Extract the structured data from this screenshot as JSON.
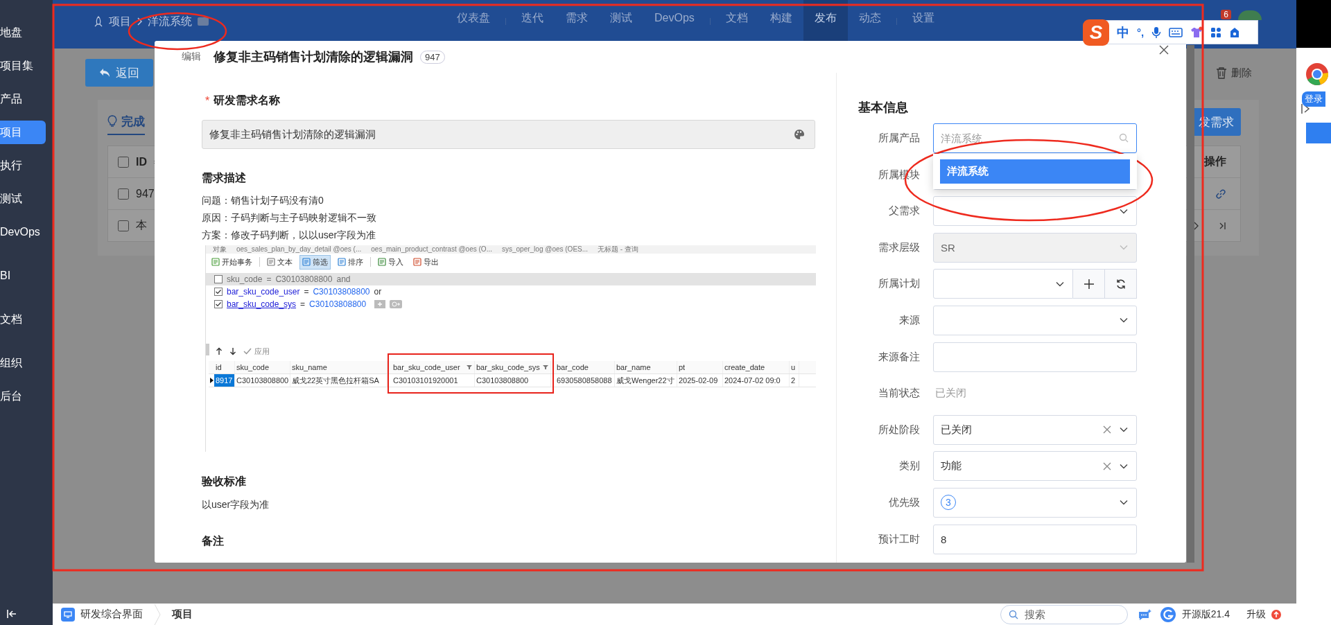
{
  "sidebar": {
    "items": [
      {
        "label": "地盘",
        "selected": false
      },
      {
        "label": "项目集",
        "selected": false
      },
      {
        "label": "产品",
        "selected": false
      },
      {
        "label": "项目",
        "selected": true
      },
      {
        "label": "执行",
        "selected": false
      },
      {
        "label": "测试",
        "selected": false
      },
      {
        "label": "DevOps",
        "selected": false
      },
      {
        "label": "BI",
        "selected": false
      },
      {
        "label": "文档",
        "selected": false
      },
      {
        "label": "组织",
        "selected": false
      },
      {
        "label": "后台",
        "selected": false
      }
    ]
  },
  "header": {
    "breadcrumb": [
      "项目",
      "洋流系统"
    ],
    "nav": [
      {
        "label": "仪表盘",
        "selected": false
      },
      {
        "label": "迭代",
        "selected": false
      },
      {
        "label": "需求",
        "selected": false
      },
      {
        "label": "测试",
        "selected": false
      },
      {
        "label": "DevOps",
        "selected": false
      },
      {
        "label": "文档",
        "selected": false
      },
      {
        "label": "构建",
        "selected": false
      },
      {
        "label": "发布",
        "selected": true
      },
      {
        "label": "动态",
        "selected": false
      },
      {
        "label": "设置",
        "selected": false
      }
    ],
    "notification_count": "6"
  },
  "ime_toolbar": {
    "logo": "S",
    "mode": "中",
    "punctuation": "°,"
  },
  "page": {
    "back_button": "返回",
    "delete_button": "删除",
    "tab": "完成",
    "new_button": "发需求",
    "id_column": "ID",
    "action_column": "操作",
    "select_all_checked": false,
    "rows": [
      {
        "kind": "story",
        "text": "947",
        "checked": false
      },
      {
        "kind": "footer",
        "text": "本",
        "checked": false
      }
    ]
  },
  "modal": {
    "mode": "编辑",
    "title": "修复非主码销售计划清除的逻辑漏洞",
    "id": "947",
    "required_mark": "*",
    "name_label": "研发需求名称",
    "name_value": "修复非主码销售计划清除的逻辑漏洞",
    "description_label": "需求描述",
    "description_lines": [
      "问题：销售计划子码没有清0",
      "原因：子码判断与主子码映射逻辑不一致",
      "方案：修改子码判断，以以user字段为准"
    ],
    "screenshot": {
      "tabs": [
        "对象",
        "oes_sales_plan_by_day_detail @oes (...",
        "oes_main_product_contrast @oes (O...",
        "sys_oper_log @oes (OES...",
        "无标题 - 查询"
      ],
      "toolbar": [
        {
          "label": "开始事务",
          "selected": false
        },
        {
          "label": "文本",
          "selected": false
        },
        {
          "label": "筛选",
          "selected": true
        },
        {
          "label": "排序",
          "selected": false
        },
        {
          "label": "导入",
          "selected": false
        },
        {
          "label": "导出",
          "selected": false
        }
      ],
      "filters": [
        {
          "checked": false,
          "field": "sku_code",
          "op": "=",
          "value": "C30103808800",
          "join": "and"
        },
        {
          "checked": true,
          "field": "bar_sku_code_user",
          "op": "=",
          "value": "C30103808800",
          "join": "or"
        },
        {
          "checked": true,
          "field": "bar_sku_code_sys",
          "op": "=",
          "value": "C30103808800"
        }
      ],
      "apply": "应用",
      "columns": [
        "id",
        "sku_code",
        "sku_name",
        "bar_sku_code_user",
        "bar_sku_code_sys",
        "bar_code",
        "bar_name",
        "pt",
        "create_date",
        "u"
      ],
      "rows": [
        [
          "8917",
          "C30103808800",
          "威戈22英寸黑色拉杆箱SA",
          "C30103101920001",
          "C30103808800",
          "6930580858088",
          "威戈Wenger22寸",
          "2025-02-09",
          "2024-07-02 09:0",
          "2"
        ]
      ]
    },
    "acceptance_label": "验收标准",
    "acceptance_text": "以user字段为准",
    "notes_label": "备注",
    "info_title": "基本信息",
    "fields": [
      {
        "label": "所属产品",
        "kind": "search",
        "placeholder": "洋流系统",
        "focused": true,
        "disabled": false,
        "clearable": false,
        "options": [
          {
            "label": "洋流系统",
            "selected": true
          }
        ]
      },
      {
        "label": "所属模块",
        "kind": "select"
      },
      {
        "label": "父需求",
        "kind": "select",
        "focused": false,
        "disabled": false,
        "clearable": false
      },
      {
        "label": "需求层级",
        "kind": "select",
        "value": "SR",
        "focused": false,
        "disabled": true,
        "clearable": false
      },
      {
        "label": "所属计划",
        "kind": "plan",
        "focused": false,
        "disabled": false,
        "clearable": false
      },
      {
        "label": "来源",
        "kind": "select",
        "focused": false,
        "disabled": false,
        "clearable": false
      },
      {
        "label": "来源备注",
        "kind": "input",
        "focused": false,
        "disabled": false,
        "clearable": false
      },
      {
        "label": "当前状态",
        "kind": "text",
        "value": "已关闭",
        "focused": false,
        "disabled": false,
        "clearable": false
      },
      {
        "label": "所处阶段",
        "kind": "select",
        "value": "已关闭",
        "focused": false,
        "disabled": false,
        "clearable": true
      },
      {
        "label": "类别",
        "kind": "select",
        "value": "功能",
        "focused": false,
        "disabled": false,
        "clearable": true
      },
      {
        "label": "优先级",
        "kind": "priority",
        "value": "3",
        "focused": false,
        "disabled": false,
        "clearable": false
      },
      {
        "label": "预计工时",
        "kind": "input",
        "value": "8",
        "focused": false,
        "disabled": false,
        "clearable": false
      }
    ]
  },
  "status_bar": {
    "app": "研发综合界面",
    "current": "项目",
    "search_placeholder": "搜索",
    "edition": "开源版21.4",
    "upgrade": "升级"
  },
  "browser_sidebar": {
    "login": "登录"
  }
}
